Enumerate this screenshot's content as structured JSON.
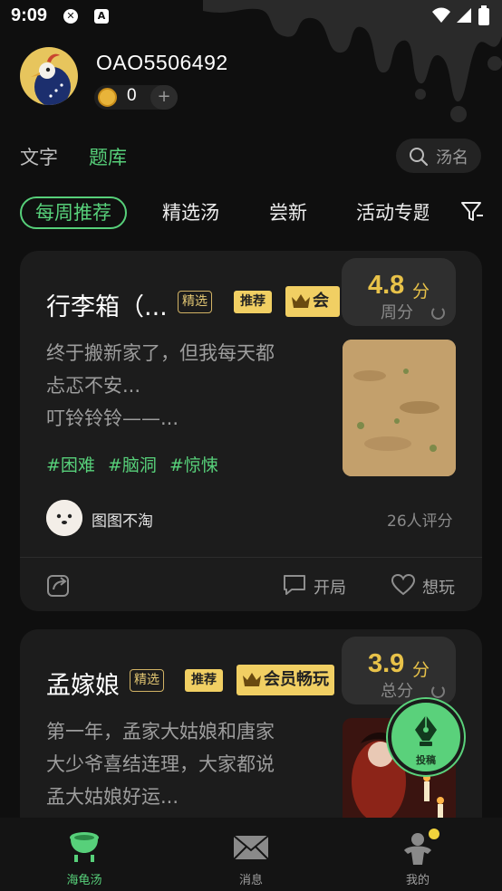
{
  "status_bar": {
    "time": "9:09",
    "icons": [
      "shield-x-icon",
      "a-icon",
      "wifi-icon",
      "signal-icon",
      "battery-icon"
    ]
  },
  "profile": {
    "username": "OAO5506492",
    "coin_count": "0",
    "add_label": "+"
  },
  "top_tabs": [
    {
      "label": "文字",
      "active": false
    },
    {
      "label": "题库",
      "active": true
    }
  ],
  "search": {
    "placeholder": "汤名"
  },
  "category_chips": [
    {
      "label": "每周推荐",
      "active": true
    },
    {
      "label": "精选汤",
      "active": false
    },
    {
      "label": "尝新",
      "active": false
    },
    {
      "label": "活动专题",
      "active": false
    }
  ],
  "cards": [
    {
      "title": "行李箱（...",
      "tag_select": "精选",
      "tag_recommend": "推荐",
      "tag_vip": "会员畅玩",
      "score": "4.8",
      "score_unit": "分",
      "score_label": "周分",
      "desc_lines": [
        "终于搬新家了，但我每天都",
        "忐忑不安...",
        "叮铃铃铃——..."
      ],
      "hashtags": [
        "#困难",
        "#脑洞",
        "#惊悚"
      ],
      "author": "图图不淘",
      "rating_count": "26人评分",
      "action_open": "开局",
      "action_want": "想玩"
    },
    {
      "title": "孟嫁娘",
      "tag_select": "精选",
      "tag_recommend": "推荐",
      "tag_vip": "会员畅玩",
      "score": "3.9",
      "score_unit": "分",
      "score_label": "总分",
      "desc_lines": [
        "第一年，孟家大姑娘和唐家",
        "大少爷喜结连理，大家都说",
        "孟大姑娘好运..."
      ]
    }
  ],
  "fab": {
    "label": "投稿"
  },
  "bottom_nav": [
    {
      "label": "海龟汤",
      "active": true,
      "icon": "cauldron-icon"
    },
    {
      "label": "消息",
      "active": false,
      "icon": "envelope-icon"
    },
    {
      "label": "我的",
      "active": false,
      "icon": "person-icon"
    }
  ],
  "colors": {
    "accent": "#57d07a",
    "gold": "#e8c249",
    "background": "#0f0f0f",
    "card": "#1c1c1c"
  }
}
